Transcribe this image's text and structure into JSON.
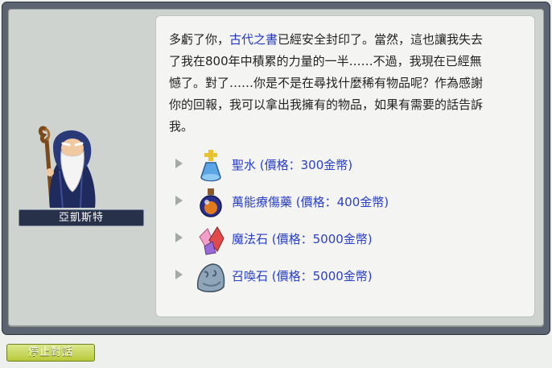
{
  "npc": {
    "name": "亞凱斯特",
    "portrait_icon": "old-wizard-portrait-icon"
  },
  "dialog": {
    "lines": [
      {
        "before": "多虧了你，",
        "highlight": "古代之書",
        "after": "已經安全封印了。當然，這也讓我失去"
      },
      {
        "before": "了我在800年中積累的力量的一半……不過，我現在已經無",
        "highlight": "",
        "after": ""
      },
      {
        "before": "憾了。對了……你是不是在尋找什麼稀有物品呢？作為感謝",
        "highlight": "",
        "after": ""
      },
      {
        "before": "你的回報，我可以拿出我擁有的物品，如果有需要的話告訴",
        "highlight": "",
        "after": ""
      },
      {
        "before": "我。",
        "highlight": "",
        "after": ""
      }
    ],
    "highlight_color": "#1f35c9"
  },
  "options": [
    {
      "label": "聖水 (價格：300金幣)",
      "icon": "holy-water-icon"
    },
    {
      "label": "萬能療傷藥 (價格：400金幣)",
      "icon": "all-cure-potion-icon"
    },
    {
      "label": "魔法石 (價格：5000金幣)",
      "icon": "magic-rock-icon"
    },
    {
      "label": "召喚石 (價格：5000金幣)",
      "icon": "summoning-rock-icon"
    }
  ],
  "footer": {
    "stop_label": "停止對話"
  },
  "colors": {
    "frame": "#5b6470",
    "panel": "#f4f4f2",
    "option_text": "#2a40c8",
    "stop_button": "#b8c93a"
  }
}
